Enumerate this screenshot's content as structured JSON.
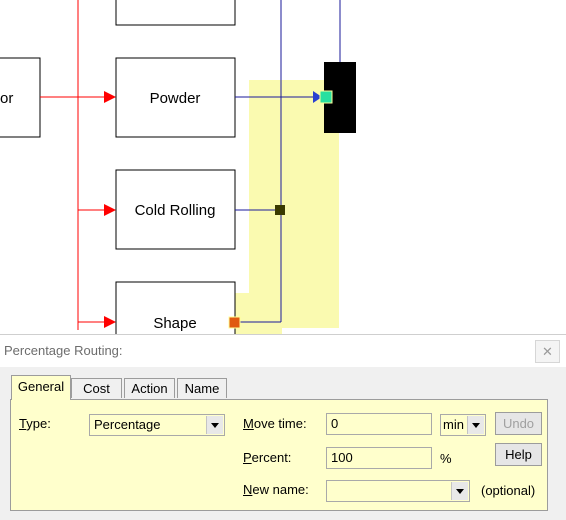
{
  "diagram": {
    "nodes": {
      "left_partial": "or",
      "powder": "Powder",
      "cold_rolling": "Cold Rolling",
      "shape": "Shape"
    },
    "colors": {
      "incoming_route": "#ff0000",
      "outgoing_route": "#1a1a9a",
      "highlight": "#fafab0",
      "target_block": "#000000"
    }
  },
  "dialog": {
    "title": "Percentage Routing:",
    "close_icon": "close-icon",
    "tabs": [
      {
        "label": "General",
        "active": true
      },
      {
        "label": "Cost",
        "active": false
      },
      {
        "label": "Action",
        "active": false
      },
      {
        "label": "Name",
        "active": false
      }
    ],
    "type_label": "Type:",
    "type_value": "Percentage",
    "move_time_label": "Move time:",
    "move_time_value": "0",
    "move_time_unit": "min",
    "percent_label": "Percent:",
    "percent_value": "100",
    "percent_unit": "%",
    "new_name_label": "New name:",
    "new_name_value": "",
    "optional_note": "(optional)",
    "undo_label": "Undo",
    "help_label": "Help"
  }
}
